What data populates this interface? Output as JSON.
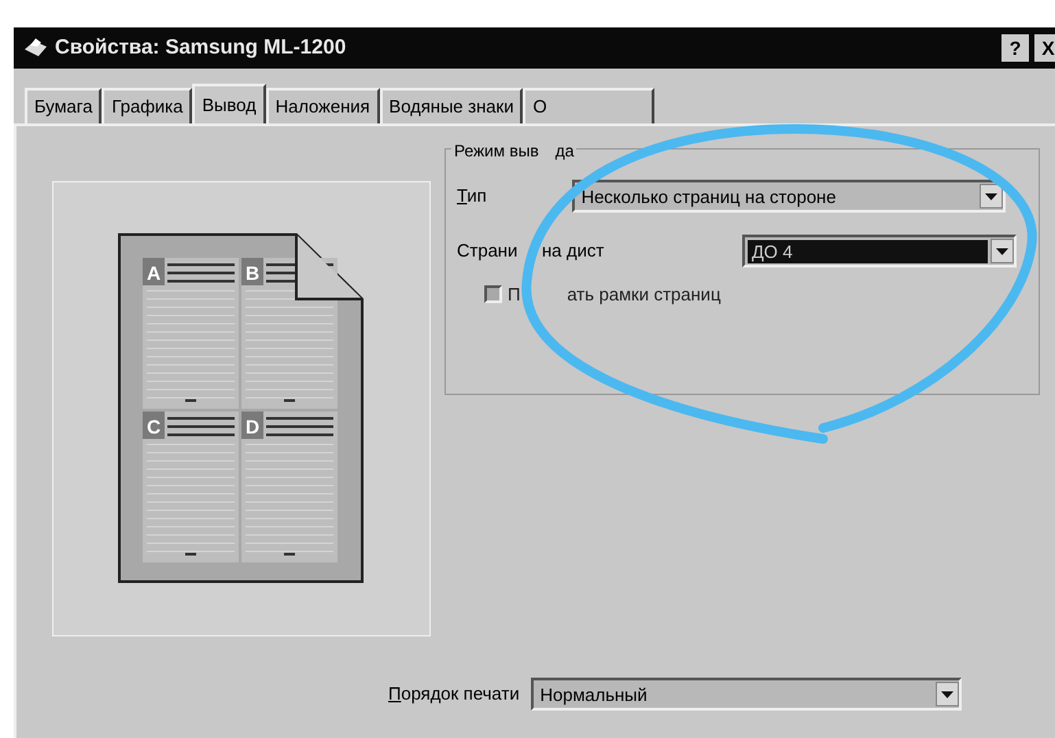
{
  "window": {
    "title": "Свойства: Samsung ML-1200",
    "help_button": "?",
    "close_button": "X"
  },
  "tabs": [
    {
      "label": "Бумага",
      "selected": false
    },
    {
      "label": "Графика",
      "selected": false
    },
    {
      "label": "Вывод",
      "selected": true
    },
    {
      "label": "Наложения",
      "selected": false
    },
    {
      "label": "Водяные знаки",
      "selected": false
    },
    {
      "label": "О",
      "selected": false
    }
  ],
  "preview": {
    "page_labels": [
      "A",
      "B",
      "C",
      "D"
    ]
  },
  "output_mode": {
    "title_parts": [
      "Режим выв",
      "да"
    ],
    "type_label": "Тип",
    "type_value": "Несколько страниц на стороне",
    "pages_label_parts": [
      "Страни",
      "на дист"
    ],
    "pages_value": "ДО 4",
    "pages_focused": true,
    "frame_checkbox": {
      "checked": false,
      "disabled": true,
      "label_parts": [
        "П",
        "ать рамки страниц"
      ]
    }
  },
  "print_order": {
    "label": "Порядок печати",
    "value": "Нормальный"
  }
}
